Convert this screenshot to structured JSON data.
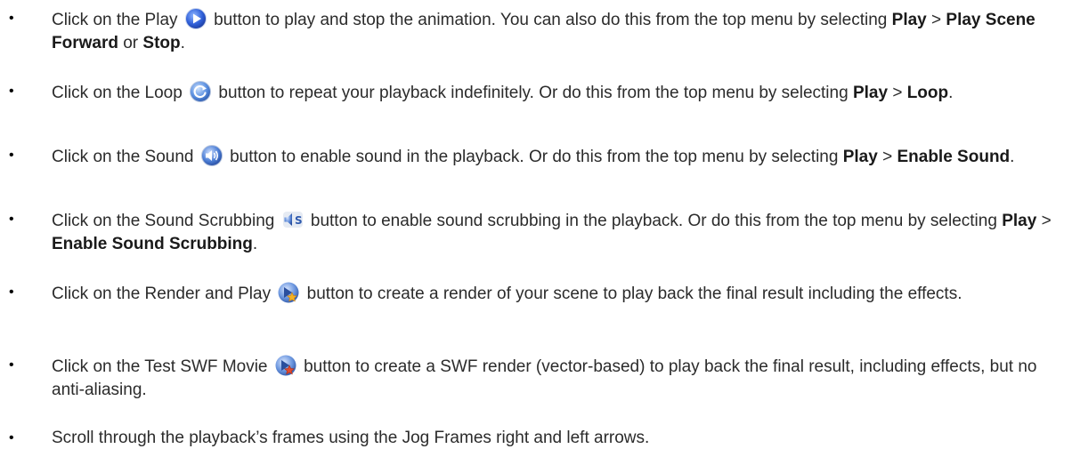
{
  "items": [
    {
      "before": "Click on the Play",
      "icon": "play-icon",
      "after": "button to play and stop the animation. You can also do this from the top menu by selecting",
      "b1": "Play",
      "sep1": ">",
      "b2": "Play Scene Forward",
      "or": "or",
      "b3": "Stop",
      "end": "."
    },
    {
      "before": "Click on the Loop",
      "icon": "loop-icon",
      "after": "button to repeat your playback indefinitely. Or do this from the top menu by selecting",
      "b1": "Play",
      "sep1": ">",
      "b2": "Loop",
      "end": "."
    },
    {
      "before": "Click on the Sound",
      "icon": "sound-icon",
      "after": "button to enable sound in the playback. Or do this from the top menu by selecting",
      "b1": "Play",
      "sep1": ">",
      "b2": "Enable Sound",
      "end": "."
    },
    {
      "before": "Click on the Sound Scrubbing",
      "icon": "sound-scrubbing-icon",
      "after": "button to enable sound scrubbing in the playback. Or do this from the top menu by selecting",
      "b1": "Play",
      "sep1": ">",
      "b2": "Enable Sound Scrubbing",
      "end": "."
    },
    {
      "before": "Click on the Render and Play",
      "icon": "render-and-play-icon",
      "after": "button to create a render of your scene to play back the final result including the effects."
    },
    {
      "before": "Click on the Test SWF Movie",
      "icon": "test-swf-movie-icon",
      "after": "button to create a SWF render (vector-based) to play back the final result, including effects, but no anti-aliasing."
    },
    {
      "text": "Scroll through the playback’s frames using the Jog Frames right and left arrows."
    }
  ],
  "bullet": "•"
}
